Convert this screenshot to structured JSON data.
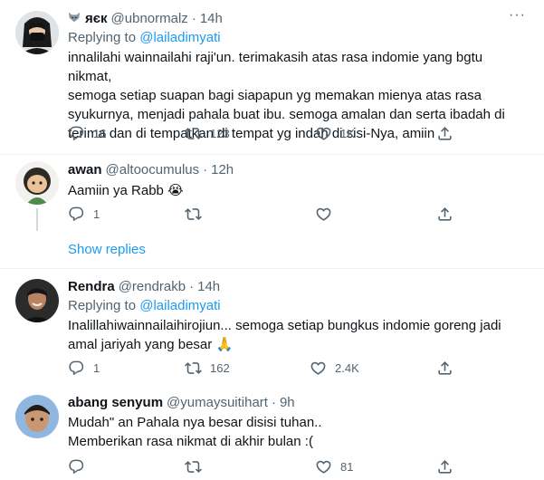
{
  "tweets": [
    {
      "name": "яєк",
      "name_prefix_icon": "fox-face-icon",
      "handle": "@ubnormalz",
      "time": "14h",
      "replying_label": "Replying to",
      "replying_to": "@lailadimyati",
      "lines": [
        "innalilahi wainnailahi raji'un. terimakasih atas rasa indomie yang bgtu nikmat,",
        "semoga setiap suapan bagi siapapun yg memakan mienya atas rasa",
        "syukurnya, menjadi pahala buat ibu. semoga amalan dan serta ibadah di",
        "terima dan di tempatkan di tempat yg indah di sisi-Nya, amiin"
      ],
      "replies": "16",
      "retweets": "123",
      "likes": "1K"
    },
    {
      "name": "awan",
      "handle": "@altoocumulus",
      "time": "12h",
      "text": "Aamiin ya Rabb",
      "emoji": "😭",
      "replies": "1",
      "retweets": "",
      "likes": ""
    },
    {
      "name": "Rendra",
      "handle": "@rendrakb",
      "time": "14h",
      "replying_label": "Replying to",
      "replying_to": "@lailadimyati",
      "lines": [
        "Inalillahiwainnailaihirojiun... semoga setiap bungkus indomie goreng jadi",
        "amal jariyah yang besar"
      ],
      "emoji": "🙏",
      "replies": "1",
      "retweets": "162",
      "likes": "2.4K"
    },
    {
      "name": "abang senyum",
      "handle": "@yumaysuitihart",
      "time": "9h",
      "lines": [
        "Mudah\" an Pahala nya besar disisi tuhan..",
        "Memberikan rasa nikmat di akhir bulan :("
      ],
      "replies": "",
      "retweets": "",
      "likes": "81"
    }
  ],
  "show_replies": "Show replies",
  "more_glyph": "···",
  "dot": "·",
  "colors": {
    "accent": "#1d9bf0",
    "secondary_text": "#536471",
    "separator": "#eff3f4",
    "thread_line": "#cfd9de"
  }
}
